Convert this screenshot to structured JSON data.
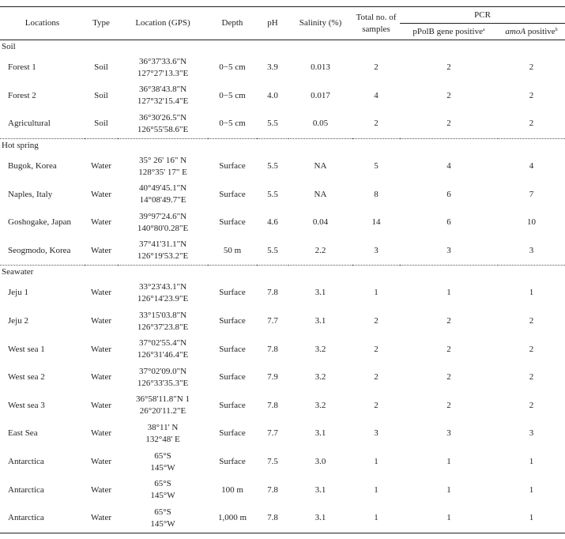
{
  "headers": {
    "locations": "Locations",
    "type": "Type",
    "gps": "Location (GPS)",
    "depth": "Depth",
    "ph": "pH",
    "salinity": "Salinity (%)",
    "total": "Total no. of samples",
    "pcr": "PCR",
    "ppolb": "pPolB gene positive",
    "ppolb_sup": "a",
    "amoa_italic": "amoA",
    "amoa_rest": " positive",
    "amoa_sup": "b"
  },
  "sections": [
    {
      "name": "Soil",
      "rows": [
        {
          "loc": "Forest 1",
          "type": "Soil",
          "gps1": "36°37'33.6\"N",
          "gps2": "127°27'13.3\"E",
          "depth": "0−5 cm",
          "ph": "3.9",
          "sal": "0.013",
          "total": "2",
          "ppolb": "2",
          "amoa": "2"
        },
        {
          "loc": "Forest 2",
          "type": "Soil",
          "gps1": "36°38'43.8\"N",
          "gps2": "127°32'15.4\"E",
          "depth": "0−5 cm",
          "ph": "4.0",
          "sal": "0.017",
          "total": "4",
          "ppolb": "2",
          "amoa": "2"
        },
        {
          "loc": "Agricultural",
          "type": "Soil",
          "gps1": "36°30'26.5\"N",
          "gps2": "126°55'58.6\"E",
          "depth": "0−5 cm",
          "ph": "5.5",
          "sal": "0.05",
          "total": "2",
          "ppolb": "2",
          "amoa": "2"
        }
      ]
    },
    {
      "name": "Hot spring",
      "rows": [
        {
          "loc": "Bugok, Korea",
          "type": "Water",
          "gps1": "35° 26' 16\" N",
          "gps2": "128°35' 17\" E",
          "depth": "Surface",
          "ph": "5.5",
          "sal": "NA",
          "total": "5",
          "ppolb": "4",
          "amoa": "4"
        },
        {
          "loc": "Naples, Italy",
          "type": "Water",
          "gps1": "40°49'45.1\"N",
          "gps2": "14°08'49.7\"E",
          "depth": "Surface",
          "ph": "5.5",
          "sal": "NA",
          "total": "8",
          "ppolb": "6",
          "amoa": "7"
        },
        {
          "loc": "Goshogake, Japan",
          "type": "Water",
          "gps1": "39°97'24.6\"N",
          "gps2": "140°80'0.28\"E",
          "depth": "Surface",
          "ph": "4.6",
          "sal": "0.04",
          "total": "14",
          "ppolb": "6",
          "amoa": "10"
        },
        {
          "loc": "Seogmodo, Korea",
          "type": "Water",
          "gps1": "37°41'31.1\"N",
          "gps2": "126°19'53.2\"E",
          "depth": "50 m",
          "ph": "5.5",
          "sal": "2.2",
          "total": "3",
          "ppolb": "3",
          "amoa": "3"
        }
      ]
    },
    {
      "name": "Seawater",
      "rows": [
        {
          "loc": "Jeju 1",
          "type": "Water",
          "gps1": "33°23'43.1\"N",
          "gps2": "126°14'23.9\"E",
          "depth": "Surface",
          "ph": "7.8",
          "sal": "3.1",
          "total": "1",
          "ppolb": "1",
          "amoa": "1"
        },
        {
          "loc": "Jeju 2",
          "type": "Water",
          "gps1": "33°15'03.8\"N",
          "gps2": "126°37'23.8\"E",
          "depth": "Surface",
          "ph": "7.7",
          "sal": "3.1",
          "total": "2",
          "ppolb": "2",
          "amoa": "2"
        },
        {
          "loc": "West sea 1",
          "type": "Water",
          "gps1": "37°02'55.4\"N",
          "gps2": "126°31'46.4\"E",
          "depth": "Surface",
          "ph": "7.8",
          "sal": "3.2",
          "total": "2",
          "ppolb": "2",
          "amoa": "2"
        },
        {
          "loc": "West sea 2",
          "type": "Water",
          "gps1": "37°02'09.0\"N",
          "gps2": "126°33'35.3\"E",
          "depth": "Surface",
          "ph": "7.9",
          "sal": "3.2",
          "total": "2",
          "ppolb": "2",
          "amoa": "2"
        },
        {
          "loc": "West sea 3",
          "type": "Water",
          "gps1": "36°58'11.8\"N 1",
          "gps2": "26°20'11.2\"E",
          "depth": "Surface",
          "ph": "7.8",
          "sal": "3.2",
          "total": "2",
          "ppolb": "2",
          "amoa": "2"
        },
        {
          "loc": "East Sea",
          "type": "Water",
          "gps1": "38°11' N",
          "gps2": "132°48' E",
          "depth": "Surface",
          "ph": "7.7",
          "sal": "3.1",
          "total": "3",
          "ppolb": "3",
          "amoa": "3"
        },
        {
          "loc": "Antarctica",
          "type": "Water",
          "gps1": "65°S",
          "gps2": "145°W",
          "depth": "Surface",
          "ph": "7.5",
          "sal": "3.0",
          "total": "1",
          "ppolb": "1",
          "amoa": "1"
        },
        {
          "loc": "Antarctica",
          "type": "Water",
          "gps1": "65°S",
          "gps2": "145°W",
          "depth": "100 m",
          "ph": "7.8",
          "sal": "3.1",
          "total": "1",
          "ppolb": "1",
          "amoa": "1"
        },
        {
          "loc": "Antarctica",
          "type": "Water",
          "gps1": "65°S",
          "gps2": "145°W",
          "depth": "1,000 m",
          "ph": "7.8",
          "sal": "3.1",
          "total": "1",
          "ppolb": "1",
          "amoa": "1"
        }
      ]
    }
  ]
}
